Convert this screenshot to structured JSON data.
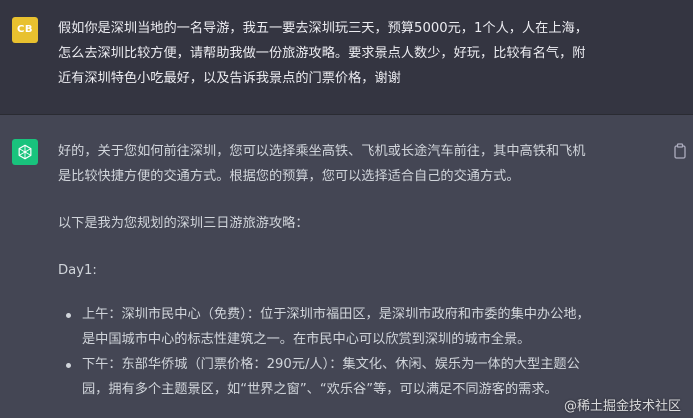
{
  "user_message": {
    "avatar_initials": "CB",
    "lines": [
      "假如你是深圳当地的一名导游，我五一要去深圳玩三天，预算5000元，1个人，人在上海，",
      "怎么去深圳比较方便，请帮助我做一份旅游攻略。要求景点人数少，好玩，比较有名气，附",
      "近有深圳特色小吃最好，以及告诉我景点的门票价格，谢谢"
    ]
  },
  "assistant_message": {
    "para1_lines": [
      "好的，关于您如何前往深圳，您可以选择乘坐高铁、飞机或长途汽车前往，其中高铁和飞机",
      "是比较快捷方便的交通方式。根据您的预算，您可以选择适合自己的交通方式。"
    ],
    "para2": "以下是我为您规划的深圳三日游旅游攻略：",
    "para3": "Day1:",
    "bullets": [
      {
        "lines": [
          "上午：深圳市民中心（免费）：位于深圳市福田区，是深圳市政府和市委的集中办公地，",
          "是中国城市中心的标志性建筑之一。在市民中心可以欣赏到深圳的城市全景。"
        ]
      },
      {
        "lines": [
          "下午：东部华侨城（门票价格：290元/人）：集文化、休闲、娱乐为一体的大型主题公",
          "园，拥有多个主题景区，如“世界之窗”、“欢乐谷”等，可以满足不同游客的需求。"
        ]
      }
    ]
  },
  "watermark": "@稀土掘金技术社区",
  "colors": {
    "user_bg": "#343541",
    "assistant_bg": "#444654",
    "user_avatar": "#e8c12f",
    "assistant_avatar": "#19c37d"
  }
}
